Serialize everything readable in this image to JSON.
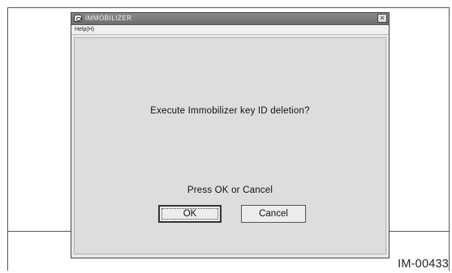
{
  "window": {
    "title": "IMMOBILIZER",
    "close_label": "×",
    "menu": {
      "help_label": "Help(H)"
    }
  },
  "dialog": {
    "message": "Execute Immobilizer key ID deletion?",
    "prompt": "Press OK or Cancel",
    "ok_label": "OK",
    "cancel_label": "Cancel"
  },
  "figure_code": "IM-00433"
}
